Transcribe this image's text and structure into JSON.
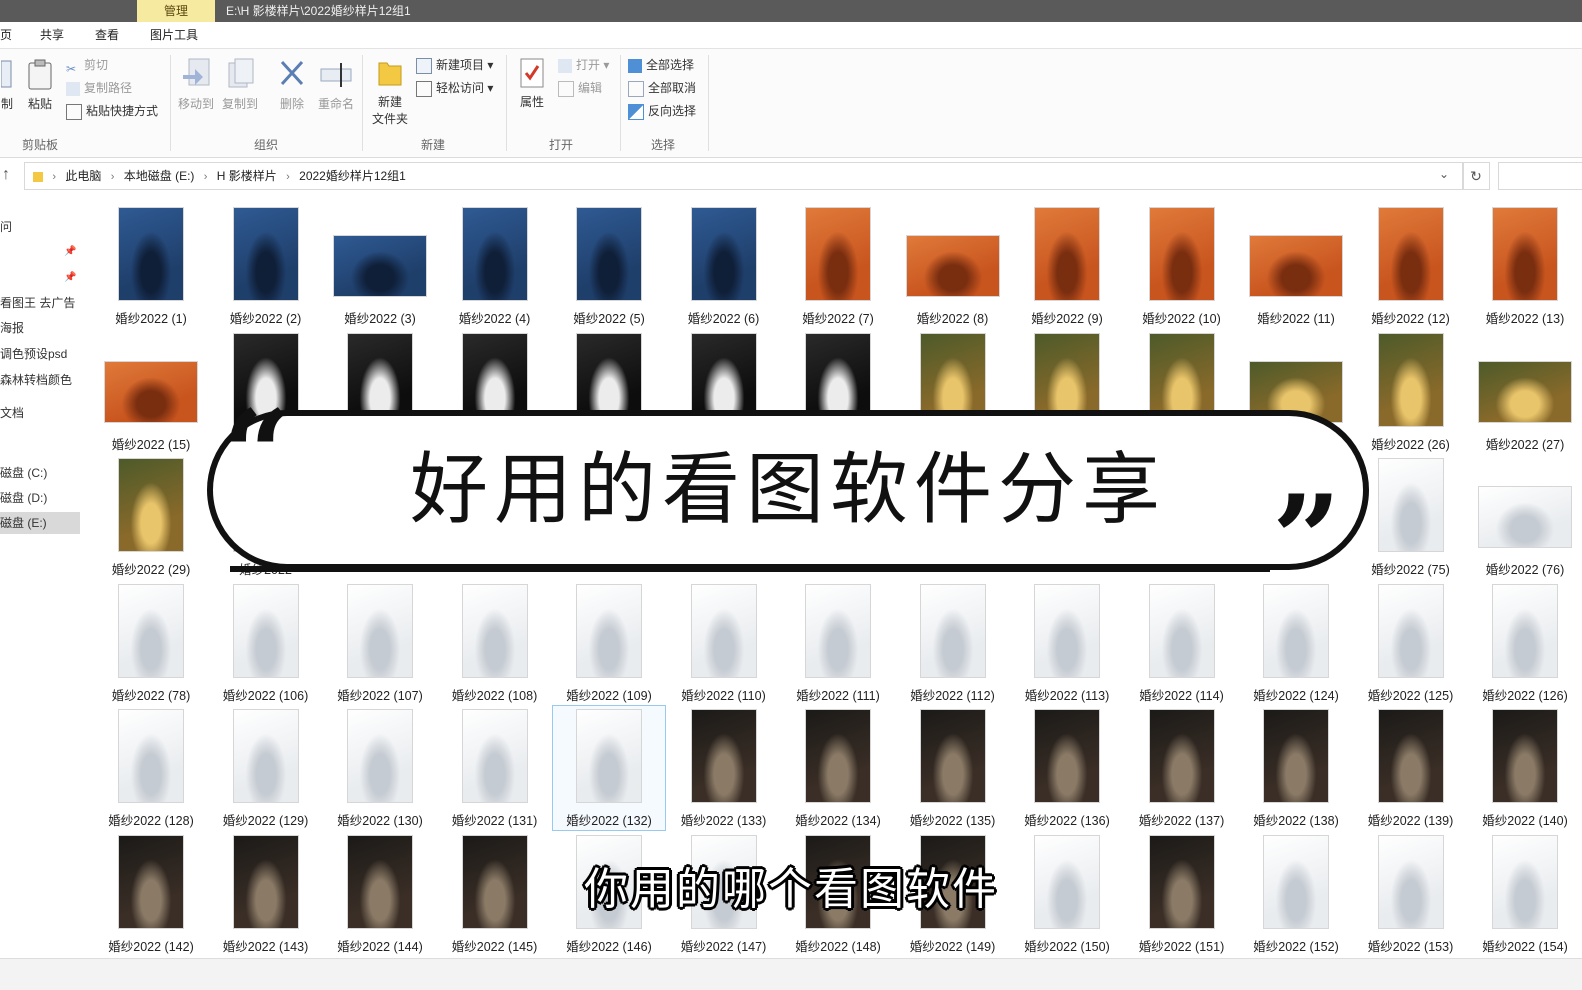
{
  "titlebar": {
    "manage_tab": "管理",
    "path": "E:\\H 影楼样片\\2022婚纱样片12组1"
  },
  "tabs": [
    "页",
    "共享",
    "查看",
    "图片工具"
  ],
  "ribbon": {
    "clipboard": {
      "copy_partial": "制",
      "paste": "粘贴",
      "cut": "剪切",
      "copy_path": "复制路径",
      "paste_shortcut": "粘贴快捷方式",
      "label": "剪贴板"
    },
    "organize": {
      "move_to": "移动到",
      "copy_to": "复制到",
      "delete": "删除",
      "rename": "重命名",
      "label": "组织"
    },
    "new": {
      "new_folder_1": "新建",
      "new_folder_2": "文件夹",
      "new_item": "新建项目 ▾",
      "easy_access": "轻松访问 ▾",
      "label": "新建"
    },
    "open": {
      "properties": "属性",
      "open": "打开 ▾",
      "edit": "编辑",
      "label": "打开"
    },
    "select": {
      "select_all": "全部选择",
      "select_none": "全部取消",
      "invert": "反向选择",
      "label": "选择"
    }
  },
  "address": {
    "crumbs": [
      "此电脑",
      "本地磁盘 (E:)",
      "H 影楼样片",
      "2022婚纱样片12组1"
    ]
  },
  "nav": {
    "items": [
      "问",
      "看图王 去广告",
      "海报",
      "调色预设psd",
      "森林转档颜色",
      "文档",
      "磁盘 (C:)",
      "磁盘 (D:)",
      "磁盘 (E:)"
    ]
  },
  "thumbnails": {
    "rows": [
      [
        "婚纱2022 (1)",
        "婚纱2022 (2)",
        "婚纱2022 (3)",
        "婚纱2022 (4)",
        "婚纱2022 (5)",
        "婚纱2022 (6)",
        "婚纱2022 (7)",
        "婚纱2022 (8)",
        "婚纱2022 (9)",
        "婚纱2022 (10)",
        "婚纱2022 (11)",
        "婚纱2022 (12)",
        "婚纱2022 (13)"
      ],
      [
        "婚纱2022 (15)",
        "",
        "",
        "",
        "",
        "",
        "",
        "",
        "",
        "",
        "",
        "婚纱2022 (26)",
        "婚纱2022 (27)"
      ],
      [
        "婚纱2022 (29)",
        "婚纱2022",
        "",
        "",
        "",
        "",
        "",
        "",
        "",
        "",
        "",
        "婚纱2022 (75)",
        "婚纱2022 (76)"
      ],
      [
        "婚纱2022 (78)",
        "婚纱2022 (106)",
        "婚纱2022 (107)",
        "婚纱2022 (108)",
        "婚纱2022 (109)",
        "婚纱2022 (110)",
        "婚纱2022 (111)",
        "婚纱2022 (112)",
        "婚纱2022 (113)",
        "婚纱2022 (114)",
        "婚纱2022 (124)",
        "婚纱2022 (125)",
        "婚纱2022 (126)"
      ],
      [
        "婚纱2022 (128)",
        "婚纱2022 (129)",
        "婚纱2022 (130)",
        "婚纱2022 (131)",
        "婚纱2022 (132)",
        "婚纱2022 (133)",
        "婚纱2022 (134)",
        "婚纱2022 (135)",
        "婚纱2022 (136)",
        "婚纱2022 (137)",
        "婚纱2022 (138)",
        "婚纱2022 (139)",
        "婚纱2022 (140)"
      ],
      [
        "婚纱2022 (142)",
        "婚纱2022 (143)",
        "婚纱2022 (144)",
        "婚纱2022 (145)",
        "婚纱2022 (146)",
        "婚纱2022 (147)",
        "婚纱2022 (148)",
        "婚纱2022 (149)",
        "婚纱2022 (150)",
        "婚纱2022 (151)",
        "婚纱2022 (152)",
        "婚纱2022 (153)",
        "婚纱2022 (154)"
      ]
    ],
    "palettes": [
      "blue-studio",
      "orange-studio",
      "black-studio",
      "golden-outdoor",
      "white-studio",
      "dark-interior"
    ]
  },
  "overlay": {
    "headline": "好用的看图软件分享",
    "quote_open": "“",
    "quote_close": "”",
    "subtitle": "你用的哪个看图软件"
  },
  "colors": {
    "titlebar": "#5a5a5a",
    "manage_tab": "#f6e9a0",
    "selection": "#d9d9d9"
  }
}
